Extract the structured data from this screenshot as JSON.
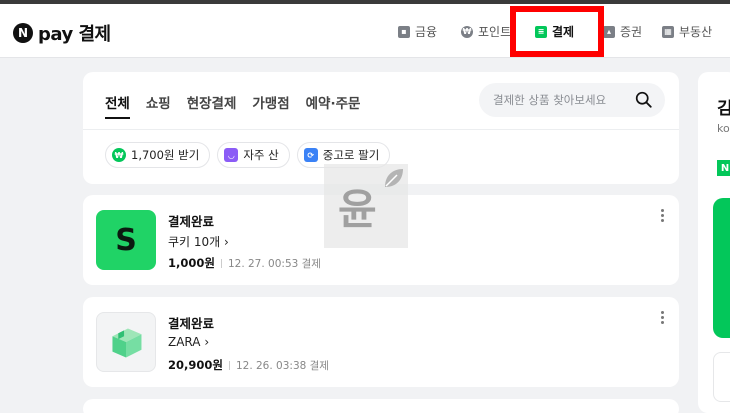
{
  "header": {
    "logo_letter": "N",
    "logo_text": "pay 결제",
    "nav": [
      {
        "label": "금융",
        "icon": "wallet-icon"
      },
      {
        "label": "포인트",
        "icon": "point-icon"
      },
      {
        "label": "결제",
        "icon": "receipt-icon",
        "active": true
      },
      {
        "label": "증권",
        "icon": "chart-icon"
      },
      {
        "label": "부동산",
        "icon": "building-icon"
      }
    ]
  },
  "tabs": [
    "전체",
    "쇼핑",
    "현장결제",
    "가맹점",
    "예약·주문"
  ],
  "search": {
    "placeholder": "결제한 상품 찾아보세요"
  },
  "chips": [
    {
      "label": "1,700원 받기",
      "icon": "npay-point-icon",
      "color": "#03c75a"
    },
    {
      "label": "자주 산",
      "icon": "shopping-bag-icon",
      "color": "#8b5cf6"
    },
    {
      "label": "중고로 팔기",
      "icon": "recycle-icon",
      "color": "#3b82f6"
    }
  ],
  "orders": [
    {
      "status": "결제완료",
      "product": "쿠키 10개",
      "amount": "1,000원",
      "time": "12. 27. 00:53 결제",
      "thumb_letter": "S",
      "thumb_color": "#20d366"
    },
    {
      "status": "결제완료",
      "product": "ZARA",
      "amount": "20,900원",
      "time": "12. 26. 03:38 결제"
    }
  ],
  "watermark": {
    "text": "윤"
  },
  "side": {
    "partial_title": "김",
    "partial_sub": "ko",
    "badge": "N"
  },
  "colors": {
    "accent": "#03c75a",
    "highlight": "#ff0000"
  }
}
